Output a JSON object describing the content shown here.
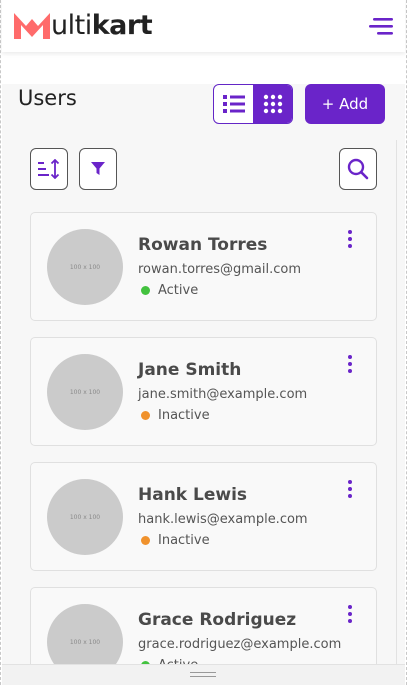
{
  "app": {
    "logo_first": "M",
    "logo_mid": "ulti",
    "logo_bold": "kart",
    "brand_color": "#6a24c9",
    "logo_color": "#ff6b6b"
  },
  "header": {
    "menu_icon": "hamburger-menu-icon"
  },
  "page": {
    "title": "Users",
    "add_label": "+ Add"
  },
  "toolbar": {
    "sort_icon": "sort-icon",
    "filter_icon": "filter-icon",
    "search_icon": "search-icon",
    "view_modes": [
      "list",
      "grid"
    ],
    "active_view": "grid"
  },
  "users": [
    {
      "avatar": "100 x 100",
      "name": "Rowan Torres",
      "email": "rowan.torres@gmail.com",
      "status": "Active",
      "status_color": "#43c23f"
    },
    {
      "avatar": "100 x 100",
      "name": "Jane Smith",
      "email": "jane.smith@example.com",
      "status": "Inactive",
      "status_color": "#f0922d"
    },
    {
      "avatar": "100 x 100",
      "name": "Hank Lewis",
      "email": "hank.lewis@example.com",
      "status": "Inactive",
      "status_color": "#f0922d"
    },
    {
      "avatar": "100 x 100",
      "name": "Grace Rodriguez",
      "email": "grace.rodriguez@example.com",
      "status": "Active",
      "status_color": "#43c23f"
    }
  ]
}
